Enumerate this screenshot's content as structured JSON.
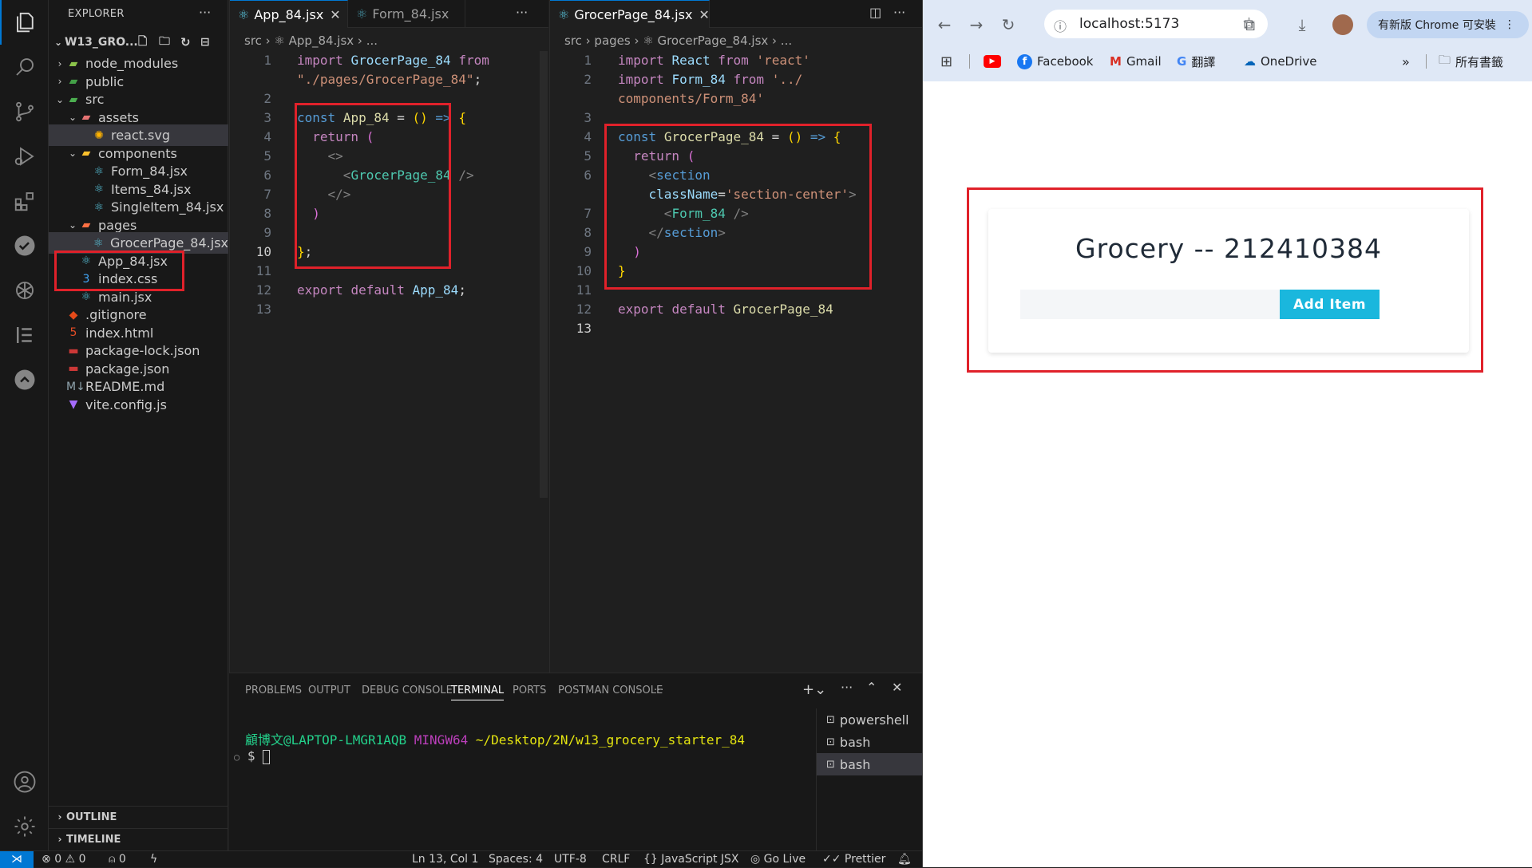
{
  "explorer": {
    "title": "EXPLORER",
    "project": "W13_GRO...",
    "tree": [
      {
        "label": "node_modules",
        "indent": 1,
        "chev": "›",
        "icon": "folder-node"
      },
      {
        "label": "public",
        "indent": 1,
        "chev": "›",
        "icon": "folder-public"
      },
      {
        "label": "src",
        "indent": 1,
        "chev": "⌄",
        "icon": "folder-src"
      },
      {
        "label": "assets",
        "indent": 2,
        "chev": "⌄",
        "icon": "folder-assets"
      },
      {
        "label": "react.svg",
        "indent": 3,
        "chev": "",
        "icon": "svg-file"
      },
      {
        "label": "components",
        "indent": 2,
        "chev": "⌄",
        "icon": "folder-components"
      },
      {
        "label": "Form_84.jsx",
        "indent": 3,
        "chev": "",
        "icon": "react"
      },
      {
        "label": "Items_84.jsx",
        "indent": 3,
        "chev": "",
        "icon": "react"
      },
      {
        "label": "SingleItem_84.jsx",
        "indent": 3,
        "chev": "",
        "icon": "react"
      },
      {
        "label": "pages",
        "indent": 2,
        "chev": "⌄",
        "icon": "folder-pages"
      },
      {
        "label": "GrocerPage_84.jsx",
        "indent": 3,
        "chev": "",
        "icon": "react"
      },
      {
        "label": "App_84.jsx",
        "indent": 2,
        "chev": "",
        "icon": "react"
      },
      {
        "label": "index.css",
        "indent": 2,
        "chev": "",
        "icon": "css"
      },
      {
        "label": "main.jsx",
        "indent": 2,
        "chev": "",
        "icon": "react"
      },
      {
        "label": ".gitignore",
        "indent": 1,
        "chev": "",
        "icon": "git"
      },
      {
        "label": "index.html",
        "indent": 1,
        "chev": "",
        "icon": "html"
      },
      {
        "label": "package-lock.json",
        "indent": 1,
        "chev": "",
        "icon": "npm"
      },
      {
        "label": "package.json",
        "indent": 1,
        "chev": "",
        "icon": "npm"
      },
      {
        "label": "README.md",
        "indent": 1,
        "chev": "",
        "icon": "md"
      },
      {
        "label": "vite.config.js",
        "indent": 1,
        "chev": "",
        "icon": "vite"
      }
    ],
    "outline": "OUTLINE",
    "timeline": "TIMELINE"
  },
  "editor_left": {
    "tabs": [
      {
        "label": "App_84.jsx",
        "active": true
      },
      {
        "label": "Form_84.jsx",
        "active": false
      }
    ],
    "breadcrumb": "src › ⚛ App_84.jsx › ..."
  },
  "editor_right": {
    "tabs": [
      {
        "label": "GrocerPage_84.jsx",
        "active": true
      }
    ],
    "breadcrumb": "src › pages › ⚛ GrocerPage_84.jsx › ..."
  },
  "panel": {
    "tabs": [
      "PROBLEMS",
      "OUTPUT",
      "DEBUG CONSOLE",
      "TERMINAL",
      "PORTS",
      "POSTMAN CONSOLE"
    ],
    "active_tab": "TERMINAL",
    "prompt_user": "顧博文@LAPTOP-LMGR1AQB",
    "prompt_env": "MINGW64",
    "prompt_path": "~/Desktop/2N/w13_grocery_starter_84",
    "prompt_symbol": "$",
    "terminals": [
      "powershell",
      "bash",
      "bash"
    ]
  },
  "status": {
    "errors": "0",
    "warnings": "0",
    "ports": "0",
    "position": "Ln 13, Col 1",
    "spaces": "Spaces: 4",
    "encoding": "UTF-8",
    "eol": "CRLF",
    "language": "JavaScript JSX",
    "golive": "Go Live",
    "prettier": "Prettier"
  },
  "browser": {
    "url": "localhost:5173",
    "update": "有新版 Chrome 可安裝",
    "bookmarks": [
      "Facebook",
      "Gmail",
      "翻譯",
      "OneDrive"
    ],
    "all_bookmarks": "所有書籤",
    "app_title": "Grocery -- 212410384",
    "input_value": "",
    "add_button": "Add Item",
    "accent_color": "#1ab7dd"
  }
}
